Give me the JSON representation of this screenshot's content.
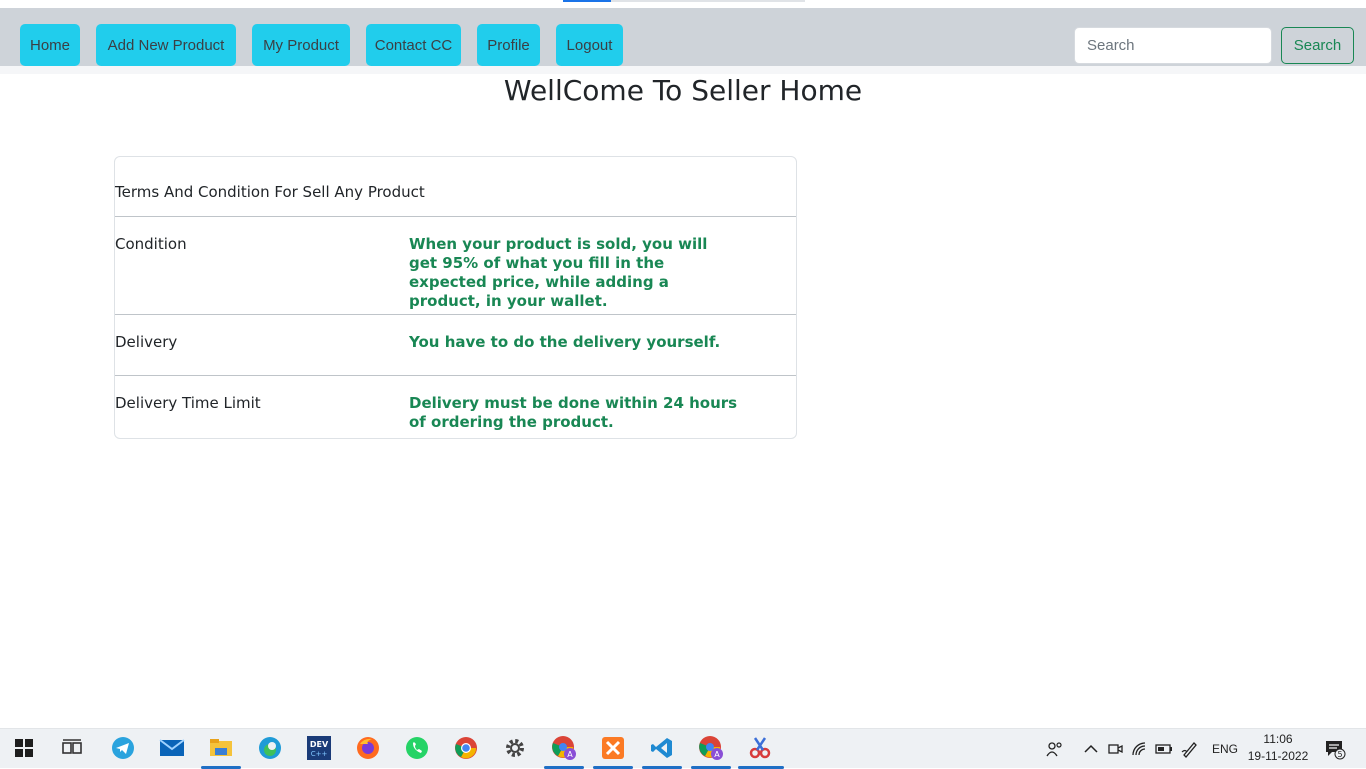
{
  "nav": {
    "items": [
      {
        "label": "Home"
      },
      {
        "label": "Add New Product"
      },
      {
        "label": "My Product"
      },
      {
        "label": "Contact CC"
      },
      {
        "label": "Profile"
      },
      {
        "label": "Logout"
      }
    ],
    "search_placeholder": "Search",
    "search_button": "Search",
    "accent": "#21cdec"
  },
  "main": {
    "title": "WellCome To Seller Home",
    "card": {
      "header": "Terms And Condition For Sell Any Product",
      "rows": [
        {
          "label": "Condition",
          "value": "When your product is sold, you will get 95% of what you fill in the expected price, while adding a product, in your wallet."
        },
        {
          "label": "Delivery",
          "value": "You have to do the delivery yourself."
        },
        {
          "label": "Delivery Time Limit",
          "value": "Delivery must be done within 24 hours of ordering the product."
        }
      ],
      "value_color": "#198754"
    }
  },
  "taskbar": {
    "apps": [
      "start-icon",
      "task-view-icon",
      "telegram-icon",
      "mail-icon",
      "file-explorer-icon",
      "edge-icon",
      "devc-icon",
      "firefox-icon",
      "whatsapp-icon",
      "chrome-icon",
      "settings-icon",
      "chrome-profile-icon",
      "xampp-icon",
      "vscode-icon",
      "chrome-profile-2-icon",
      "snipping-tool-icon"
    ],
    "language": "ENG",
    "time": "11:06",
    "date": "19-11-2022",
    "notification_count": "5"
  }
}
